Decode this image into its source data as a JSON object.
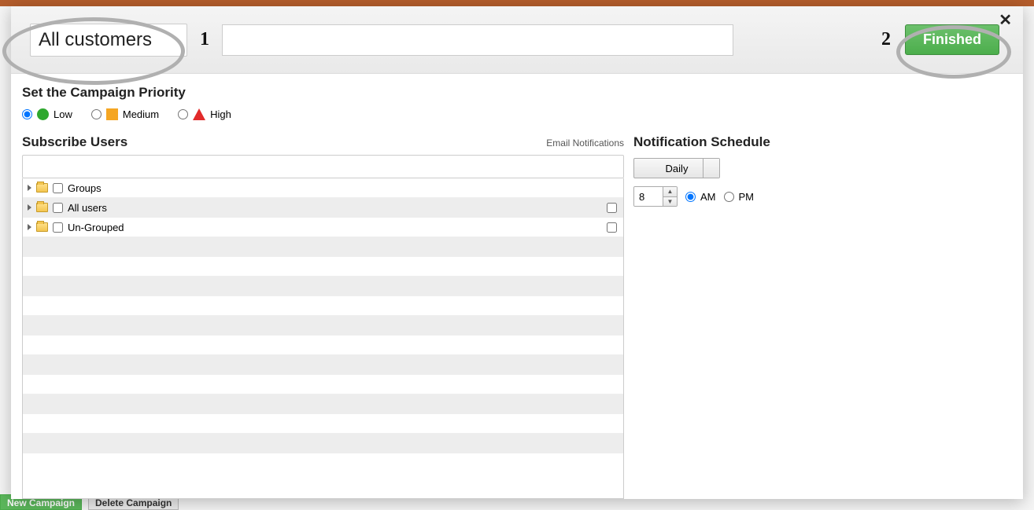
{
  "background": {
    "new_campaign_btn": "New Campaign",
    "delete_campaign_btn": "Delete Campaign"
  },
  "header": {
    "name_value": "All customers",
    "step1": "1",
    "step2": "2",
    "finished_label": "Finished"
  },
  "priority": {
    "title": "Set the Campaign Priority",
    "low": "Low",
    "medium": "Medium",
    "high": "High",
    "selected": "low"
  },
  "subscribe": {
    "title": "Subscribe Users",
    "email_label": "Email Notifications",
    "filter_value": "",
    "tree": [
      {
        "label": "Groups",
        "has_right_chk": false
      },
      {
        "label": "All users",
        "has_right_chk": true
      },
      {
        "label": "Un-Grouped",
        "has_right_chk": true
      }
    ]
  },
  "schedule": {
    "title": "Notification Schedule",
    "frequency": "Daily",
    "hour": "8",
    "am": "AM",
    "pm": "PM",
    "ampm_selected": "AM"
  }
}
